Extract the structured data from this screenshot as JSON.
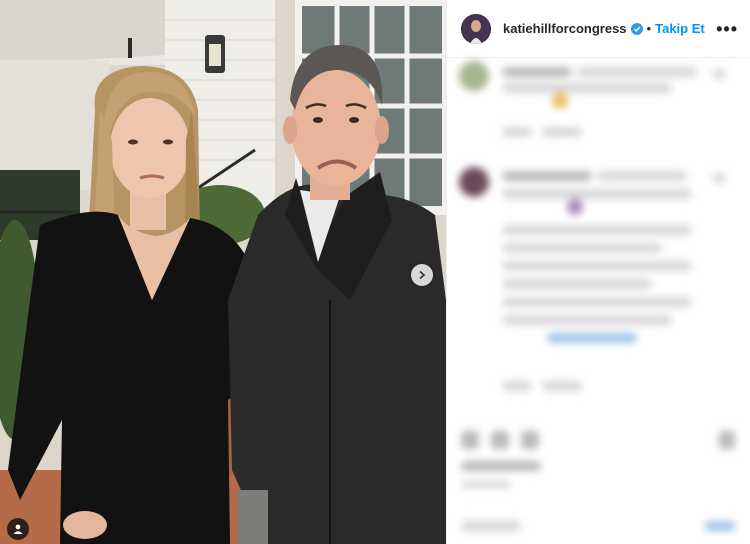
{
  "post": {
    "username": "katiehillforcongress",
    "follow_label": "Takip Et",
    "separator": "•",
    "more_label": "•••",
    "verified": true
  },
  "colors": {
    "accent": "#0095f6",
    "text": "#262626",
    "divider": "#efefef"
  },
  "icons": {
    "next": "chevron-right-icon",
    "tags": "user-tag-icon",
    "verified": "verified-badge-icon"
  }
}
